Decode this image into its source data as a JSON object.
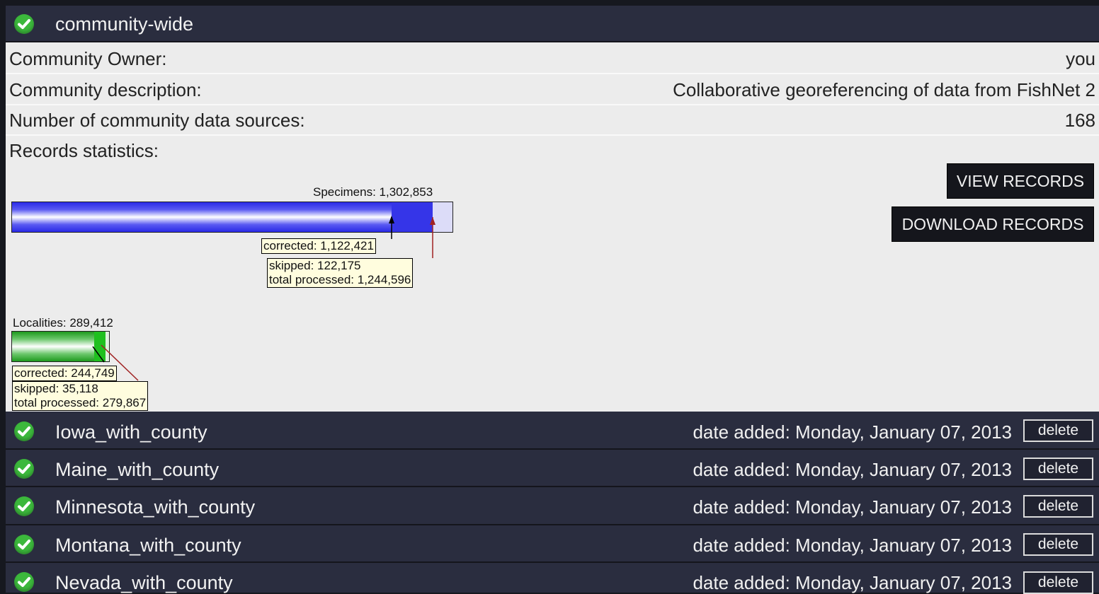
{
  "community": {
    "name": "community-wide",
    "owner_label": "Community Owner:",
    "owner_value": "you",
    "description_label": "Community description:",
    "description_value": "Collaborative georeferencing of data from FishNet 2",
    "sources_label": "Number of community data sources:",
    "sources_value": "168",
    "stats_label": "Records statistics:"
  },
  "actions": {
    "view_records": "VIEW RECORDS",
    "download_records": "DOWNLOAD RECORDS"
  },
  "specimens": {
    "label": "Specimens: 1,302,853",
    "corrected_label": "corrected: 1,122,421",
    "skipped_label": "skipped: 122,175",
    "processed_label": "total processed: 1,244,596",
    "total": 1302853,
    "corrected": 1122421,
    "processed": 1244596,
    "colors": {
      "bar": "#2323ee",
      "corrected_fill": "#2a2ae0",
      "processed_fill": "#3a46e6",
      "remaining": "#dcdcf8"
    }
  },
  "localities": {
    "label": "Localities: 289,412",
    "corrected_label": "corrected: 244,749",
    "skipped_label": "skipped: 35,118",
    "processed_label": "total processed: 279,867",
    "total": 289412,
    "corrected": 244749,
    "processed": 279867,
    "colors": {
      "bar": "#22a222",
      "corrected_fill": "#1fa81f",
      "processed_fill": "#23b823",
      "remaining": "#dff2df"
    }
  },
  "sources": [
    {
      "name": "Iowa_with_county",
      "date": "date added: Monday, January 07, 2013",
      "action": "delete"
    },
    {
      "name": "Maine_with_county",
      "date": "date added: Monday, January 07, 2013",
      "action": "delete"
    },
    {
      "name": "Minnesota_with_county",
      "date": "date added: Monday, January 07, 2013",
      "action": "delete"
    },
    {
      "name": "Montana_with_county",
      "date": "date added: Monday, January 07, 2013",
      "action": "delete"
    },
    {
      "name": "Nevada_with_county",
      "date": "date added: Monday, January 07, 2013",
      "action": "delete"
    }
  ],
  "icons": {
    "status": "check-circle-icon"
  },
  "theme": {
    "header_bg": "#2a2d3f",
    "detail_bg": "#ececec",
    "check_green": "#3cb83c"
  }
}
